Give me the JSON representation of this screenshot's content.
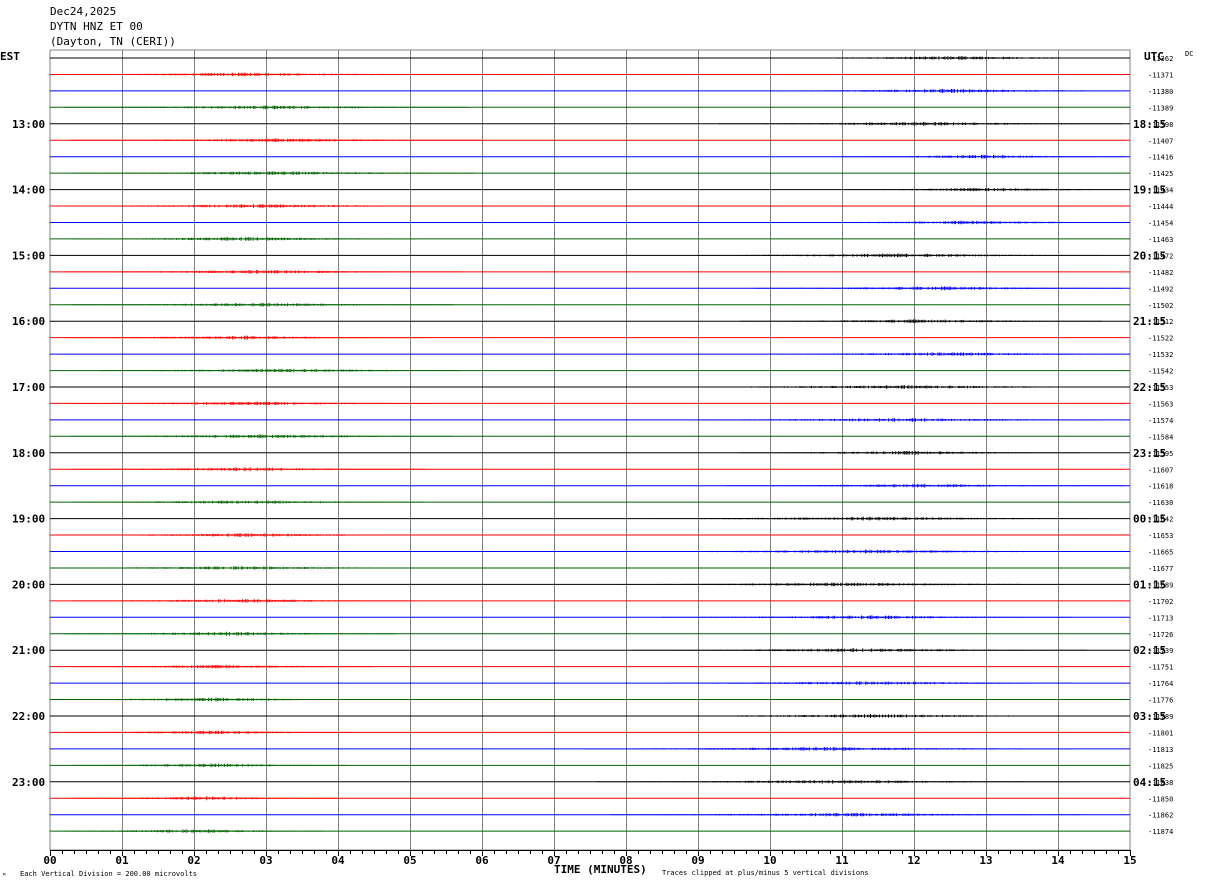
{
  "header": {
    "date": "Dec24,2025",
    "station": "DYTN HNZ ET 00",
    "location": "(Dayton, TN (CERI))"
  },
  "labels": {
    "left_tz": "EST",
    "right_tz": "UTC",
    "dc": "DC",
    "xlabel": "TIME (MINUTES)",
    "scale_note": "Each Vertical Division =  200.00 microvolts",
    "clip_note": "Traces clipped at plus/minus 5 vertical divisions"
  },
  "colors": {
    "cycle": [
      "#000000",
      "#ff0000",
      "#0000ff",
      "#006400"
    ],
    "grid": "#808080"
  },
  "chart_data": {
    "type": "line",
    "title": "DYTN HNZ ET 00",
    "xlabel": "TIME (MINUTES)",
    "xlim": [
      0,
      15
    ],
    "x_ticks": [
      "00",
      "01",
      "02",
      "03",
      "04",
      "05",
      "06",
      "07",
      "08",
      "09",
      "10",
      "11",
      "12",
      "13",
      "14",
      "15"
    ],
    "est_labels": [
      "13:00",
      "14:00",
      "15:00",
      "16:00",
      "17:00",
      "18:00",
      "19:00",
      "20:00",
      "21:00",
      "22:00",
      "23:00"
    ],
    "utc_labels": [
      "18:15",
      "19:15",
      "20:15",
      "21:15",
      "22:15",
      "23:15",
      "00:15",
      "01:15",
      "02:15",
      "03:15",
      "04:15"
    ],
    "dc_offsets": [
      "-11362",
      "-11371",
      "-11380",
      "-11389",
      "-11398",
      "-11407",
      "-11416",
      "-11425",
      "-11434",
      "-11444",
      "-11454",
      "-11463",
      "-11472",
      "-11482",
      "-11492",
      "-11502",
      "-11512",
      "-11522",
      "-11532",
      "-11542",
      "-11553",
      "-11563",
      "-11574",
      "-11584",
      "-11595",
      "-11607",
      "-11618",
      "-11630",
      "-11642",
      "-11653",
      "-11665",
      "-11677",
      "-11689",
      "-11702",
      "-11713",
      "-11726",
      "-11739",
      "-11751",
      "-11764",
      "-11776",
      "-11789",
      "-11801",
      "-11813",
      "-11825",
      "-11838",
      "-11850",
      "-11862",
      "-11874"
    ],
    "noise_windows_minutes": [
      [
        10.2,
        14.9
      ],
      [
        0.2,
        5.3
      ],
      [
        10.0,
        14.9
      ],
      [
        0.2,
        5.8
      ],
      [
        9.3,
        14.9
      ],
      [
        0.3,
        6.0
      ],
      [
        11.0,
        14.9
      ],
      [
        0.3,
        5.9
      ],
      [
        11.1,
        14.9
      ],
      [
        0.2,
        5.5
      ],
      [
        10.6,
        14.9
      ],
      [
        0.3,
        5.1
      ],
      [
        9.0,
        14.6
      ],
      [
        0.2,
        5.7
      ],
      [
        9.8,
        14.9
      ],
      [
        0.3,
        5.6
      ],
      [
        9.6,
        14.6
      ],
      [
        0.2,
        5.2
      ],
      [
        10.0,
        14.9
      ],
      [
        0.7,
        5.7
      ],
      [
        8.7,
        14.9
      ],
      [
        0.3,
        5.4
      ],
      [
        9.0,
        14.6
      ],
      [
        0.3,
        5.6
      ],
      [
        9.6,
        14.3
      ],
      [
        0.3,
        5.2
      ],
      [
        9.4,
        14.9
      ],
      [
        0.3,
        5.2
      ],
      [
        8.4,
        14.4
      ],
      [
        0.4,
        5.1
      ],
      [
        8.2,
        14.5
      ],
      [
        0.2,
        5.1
      ],
      [
        7.9,
        14.1
      ],
      [
        0.3,
        5.0
      ],
      [
        8.5,
        14.2
      ],
      [
        0.2,
        4.8
      ],
      [
        8.1,
        14.4
      ],
      [
        0.3,
        4.5
      ],
      [
        8.6,
        14.2
      ],
      [
        0.2,
        4.3
      ],
      [
        8.5,
        14.3
      ],
      [
        0.3,
        4.2
      ],
      [
        7.4,
        14.2
      ],
      [
        0.3,
        4.1
      ],
      [
        7.6,
        14.3
      ],
      [
        0.3,
        4.0
      ],
      [
        7.8,
        14.3
      ],
      [
        0.2,
        3.8
      ]
    ]
  }
}
